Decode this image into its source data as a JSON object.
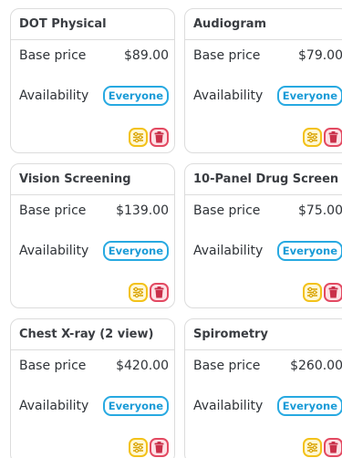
{
  "labels": {
    "base_price": "Base price",
    "availability": "Availability"
  },
  "icons": {
    "settings": "sliders-icon",
    "delete": "trash-icon"
  },
  "colors": {
    "badge": "#27a9e1",
    "settings_button": "#f3c21a",
    "delete_button": "#e34a62"
  },
  "cards": [
    {
      "title": "DOT Physical",
      "price": "$89.00",
      "availability": "Everyone"
    },
    {
      "title": "Audiogram",
      "price": "$79.00",
      "availability": "Everyone"
    },
    {
      "title": "Vision Screening",
      "price": "$139.00",
      "availability": "Everyone"
    },
    {
      "title": "10-Panel Drug Screen",
      "price": "$75.00",
      "availability": "Everyone"
    },
    {
      "title": "Chest X-ray (2 view)",
      "price": "$420.00",
      "availability": "Everyone"
    },
    {
      "title": "Spirometry",
      "price": "$260.00",
      "availability": "Everyone"
    }
  ]
}
